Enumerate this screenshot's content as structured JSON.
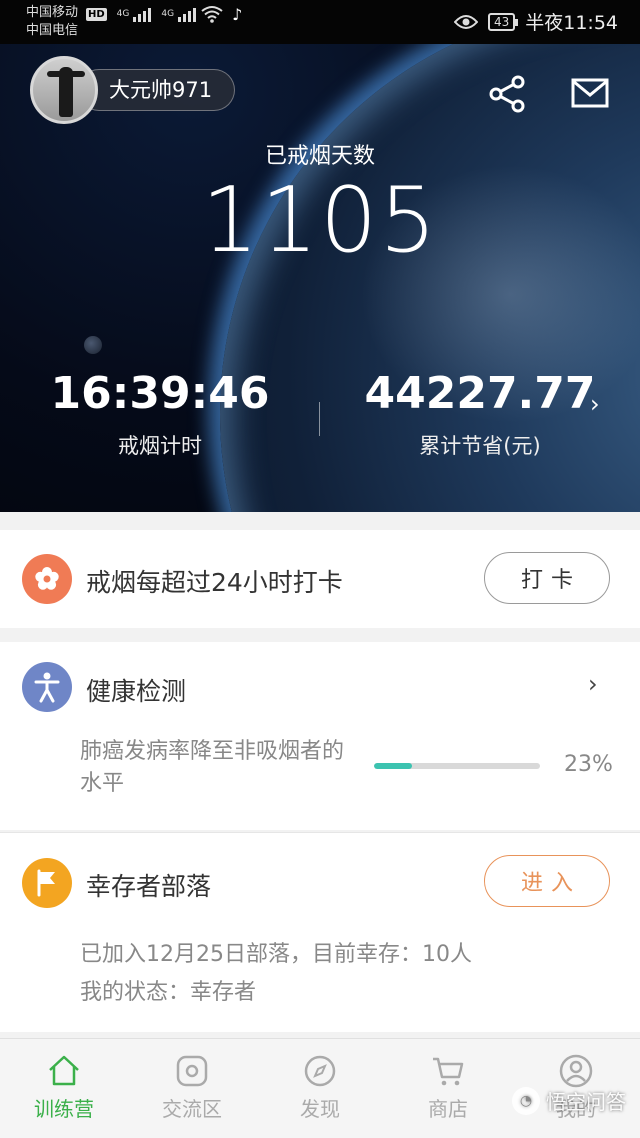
{
  "status_bar": {
    "carrier1": "中国移动",
    "carrier2": "中国电信",
    "hd": "HD",
    "net1": "4G",
    "net2": "4G",
    "battery": "43",
    "time": "半夜11:54"
  },
  "profile": {
    "username": "大元帅971"
  },
  "hero": {
    "days_label": "已戒烟天数",
    "days_value": "1105",
    "timer_value": "16:39:46",
    "timer_label": "戒烟计时",
    "savings_value": "44227.77",
    "savings_label": "累计节省(元)",
    "chevron": "›"
  },
  "checkin": {
    "title": "戒烟每超过24小时打卡",
    "button": "打卡",
    "icon_color": "#f07b55"
  },
  "health": {
    "title": "健康检测",
    "desc": "肺癌发病率降至非吸烟者的水平",
    "progress": 0.23,
    "progress_label": "23%",
    "icon_color": "#6f86c7",
    "chevron": "›"
  },
  "tribe": {
    "title": "幸存者部落",
    "button": "进入",
    "line1": "已加入12月25日部落，目前幸存：10人",
    "line2": "我的状态：幸存者",
    "icon_color": "#f3a521",
    "button_color": "#e8935a"
  },
  "nav": {
    "items": [
      {
        "label": "训练营",
        "icon": "home-icon",
        "active": true
      },
      {
        "label": "交流区",
        "icon": "chat-icon",
        "active": false
      },
      {
        "label": "发现",
        "icon": "compass-icon",
        "active": false
      },
      {
        "label": "商店",
        "icon": "cart-icon",
        "active": false
      },
      {
        "label": "我的",
        "icon": "user-icon",
        "active": false
      }
    ],
    "active_color": "#3bb04a"
  },
  "watermark": {
    "text": "悟空问答"
  }
}
